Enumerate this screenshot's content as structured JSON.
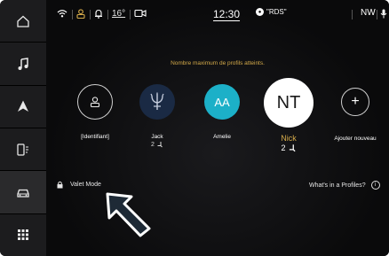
{
  "sidebar": {
    "items": [
      {
        "icon": "home-icon"
      },
      {
        "icon": "music-icon"
      },
      {
        "icon": "navigation-icon"
      },
      {
        "icon": "phone-icon"
      },
      {
        "icon": "vehicle-icon"
      },
      {
        "icon": "apps-grid-icon"
      }
    ]
  },
  "statusbar": {
    "temperature": "16°",
    "time": "12:30",
    "radio": "\"RDS\"",
    "compass": "NW"
  },
  "main": {
    "message": "Nombre maximum de profils atteints.",
    "profiles": [
      {
        "name": "[Identifiant]",
        "initials": "",
        "type": "guest"
      },
      {
        "name": "Jack",
        "initials": "",
        "seat": "2",
        "type": "logo"
      },
      {
        "name": "Amelie",
        "initials": "AA",
        "type": "teal"
      },
      {
        "name": "Nick",
        "initials": "NT",
        "seat": "2",
        "type": "active"
      },
      {
        "name": "Ajouter nouveau",
        "initials": "+",
        "type": "add"
      }
    ],
    "valet_label": "Valet Mode",
    "whats_label": "What's in a Profiles?",
    "info_glyph": "i"
  },
  "colors": {
    "accent_gold": "#d4aa4a",
    "teal": "#1cb0c8",
    "logo_blue": "#1a2a44"
  }
}
